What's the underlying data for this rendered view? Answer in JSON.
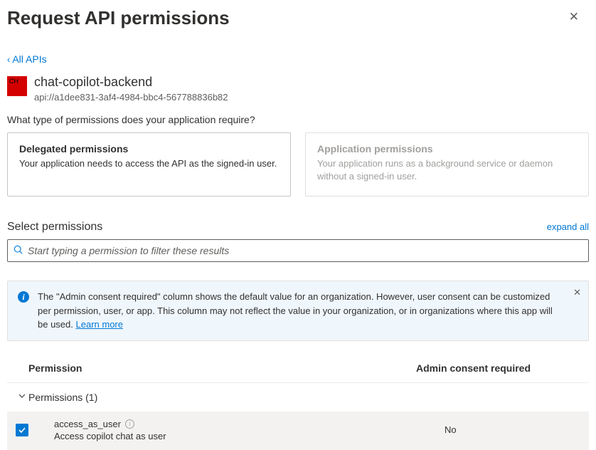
{
  "header": {
    "title": "Request API permissions"
  },
  "back_link": "All APIs",
  "app": {
    "icon_text": "CH",
    "name": "chat-copilot-backend",
    "identifier": "api://a1dee831-3af4-4984-bbc4-567788836b82"
  },
  "question": "What type of permissions does your application require?",
  "cards": {
    "delegated": {
      "title": "Delegated permissions",
      "desc": "Your application needs to access the API as the signed-in user."
    },
    "application": {
      "title": "Application permissions",
      "desc": "Your application runs as a background service or daemon without a signed-in user."
    }
  },
  "select_section": {
    "label": "Select permissions",
    "expand": "expand all",
    "search_placeholder": "Start typing a permission to filter these results"
  },
  "banner": {
    "text": "The \"Admin consent required\" column shows the default value for an organization. However, user consent can be customized per permission, user, or app. This column may not reflect the value in your organization, or in organizations where this app will be used. ",
    "link": "Learn more"
  },
  "table": {
    "headers": {
      "permission": "Permission",
      "consent": "Admin consent required"
    },
    "group": {
      "label": "Permissions (1)"
    },
    "items": [
      {
        "name": "access_as_user",
        "desc": "Access copilot chat as user",
        "consent": "No"
      }
    ]
  }
}
